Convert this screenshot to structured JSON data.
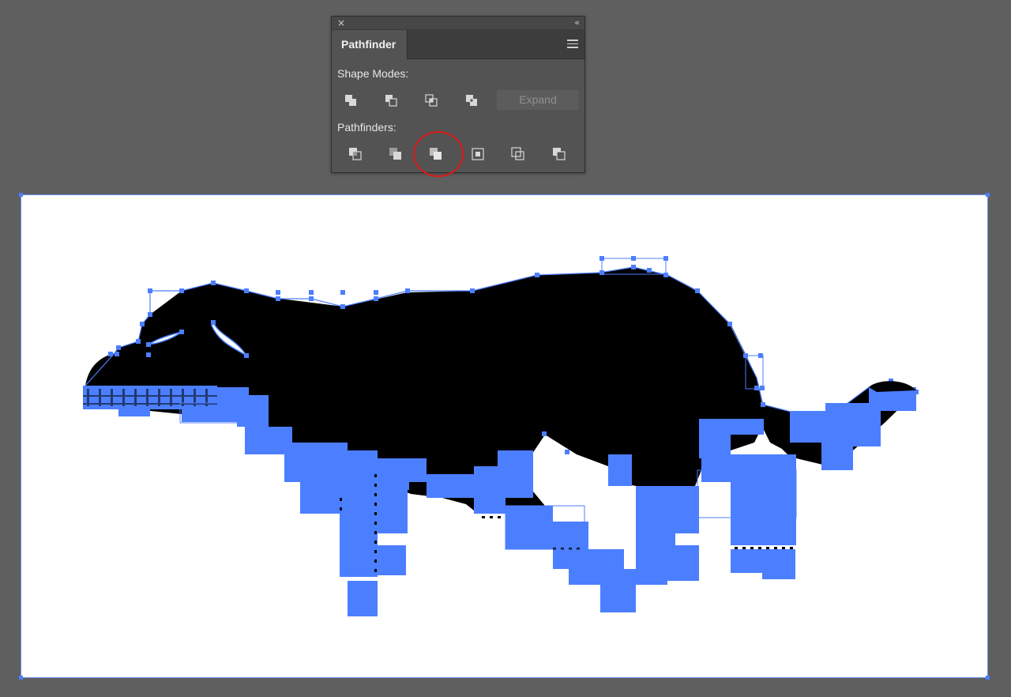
{
  "panel": {
    "close_label": "×",
    "collapse_label": "‹‹",
    "tab_title": "Pathfinder",
    "menu_icon": "hamburger-menu-icon",
    "shape_modes_label": "Shape Modes:",
    "shape_modes": [
      {
        "name": "unite",
        "icon": "unite-icon"
      },
      {
        "name": "minus-front",
        "icon": "minus-front-icon"
      },
      {
        "name": "intersect",
        "icon": "intersect-icon"
      },
      {
        "name": "exclude",
        "icon": "exclude-icon"
      }
    ],
    "expand_label": "Expand",
    "pathfinders_label": "Pathfinders:",
    "pathfinders": [
      {
        "name": "divide",
        "icon": "divide-icon"
      },
      {
        "name": "trim",
        "icon": "trim-icon"
      },
      {
        "name": "merge",
        "icon": "merge-icon",
        "highlighted": true
      },
      {
        "name": "crop",
        "icon": "crop-icon"
      },
      {
        "name": "outline",
        "icon": "outline-icon"
      },
      {
        "name": "minus-back",
        "icon": "minus-back-icon"
      }
    ],
    "highlight_color": "#e01818"
  },
  "artboard": {
    "selection_color": "#4c7fff",
    "fill_color": "#000000",
    "background_color": "#ffffff"
  }
}
